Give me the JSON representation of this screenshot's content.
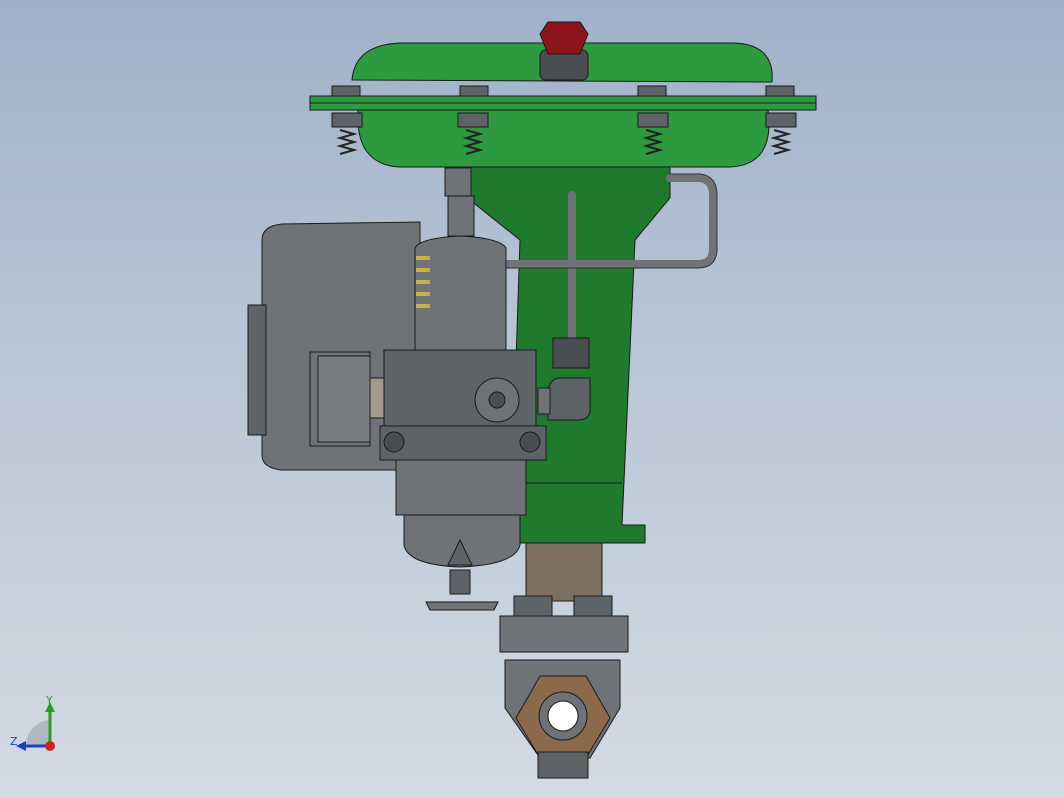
{
  "viewport": {
    "background_top": "#9fb1c8",
    "background_bottom": "#d3dbe4"
  },
  "triad": {
    "y_label": "Y",
    "z_label": "Z",
    "y_color": "#2a9a2a",
    "z_color": "#1f3fbf",
    "x_color": "#cc2222"
  },
  "colors": {
    "actuator_green": "#2e9a3f",
    "yoke_green": "#1f7a2e",
    "steel_gray": "#6f7378",
    "dark_gray": "#4a4e52",
    "cap_red": "#8a1418",
    "bronze": "#8a6a4a",
    "stem_brown": "#7d7060"
  }
}
